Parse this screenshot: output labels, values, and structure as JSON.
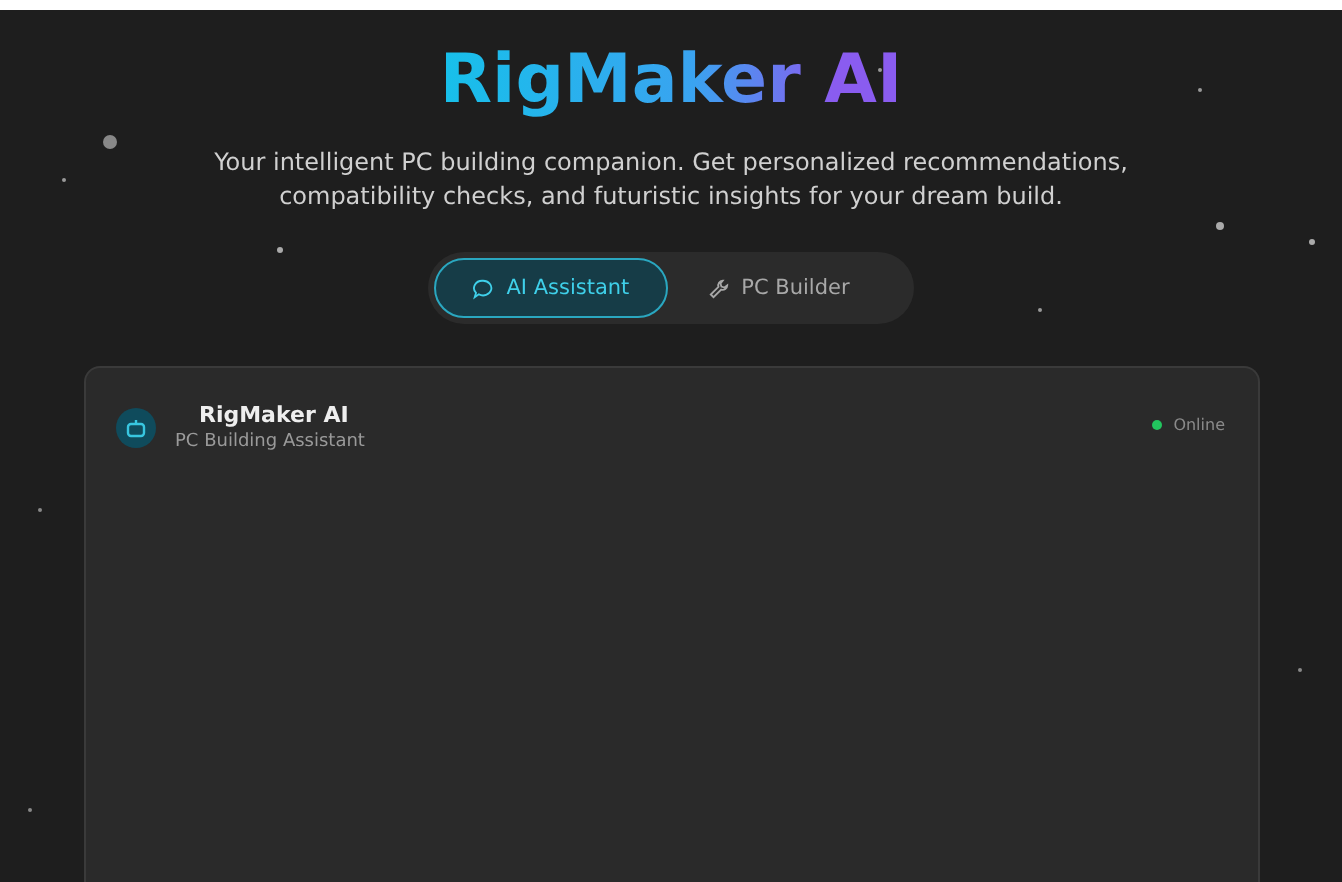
{
  "header": {
    "title": "RigMaker AI",
    "subtitle": "Your intelligent PC building companion. Get personalized recommendations, compatibility checks, and futuristic insights for your dream build."
  },
  "tabs": [
    {
      "label": "AI Assistant",
      "selected": true
    },
    {
      "label": "PC Builder",
      "selected": false
    }
  ],
  "chat": {
    "name": "RigMaker AI",
    "role": "PC Building Assistant",
    "status": {
      "label": "Online",
      "online": true
    }
  }
}
